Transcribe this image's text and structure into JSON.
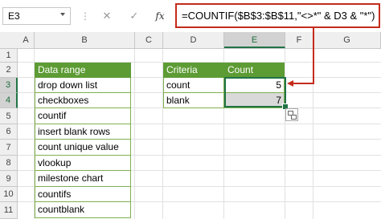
{
  "name_box": "E3",
  "formula_bar": {
    "cancel_glyph": "✕",
    "enter_glyph": "✓",
    "function_glyph": "fx",
    "formula": "=COUNTIF($B$3:$B$11,\"<>*\" & D3 & \"*\")"
  },
  "columns": [
    "A",
    "B",
    "C",
    "D",
    "E",
    "F",
    "G"
  ],
  "rows": [
    "1",
    "2",
    "3",
    "4",
    "5",
    "6",
    "7",
    "8",
    "9",
    "10",
    "11"
  ],
  "data_range": {
    "header": "Data range",
    "items": [
      "drop down list",
      "checkboxes",
      "countif",
      "insert blank rows",
      "count unique value",
      "vlookup",
      "milestone chart",
      "countifs",
      "countblank"
    ]
  },
  "criteria_table": {
    "header_criteria": "Criteria",
    "header_count": "Count",
    "rows": [
      {
        "criteria": "count",
        "count": "5"
      },
      {
        "criteria": "blank",
        "count": "7"
      }
    ]
  },
  "colors": {
    "header_green": "#5d9b34",
    "selection_green": "#217346",
    "annotation_red": "#c42b1c"
  },
  "icons": [
    "chevron-down-icon",
    "quick-analysis-icon",
    "arrow-left-icon"
  ]
}
